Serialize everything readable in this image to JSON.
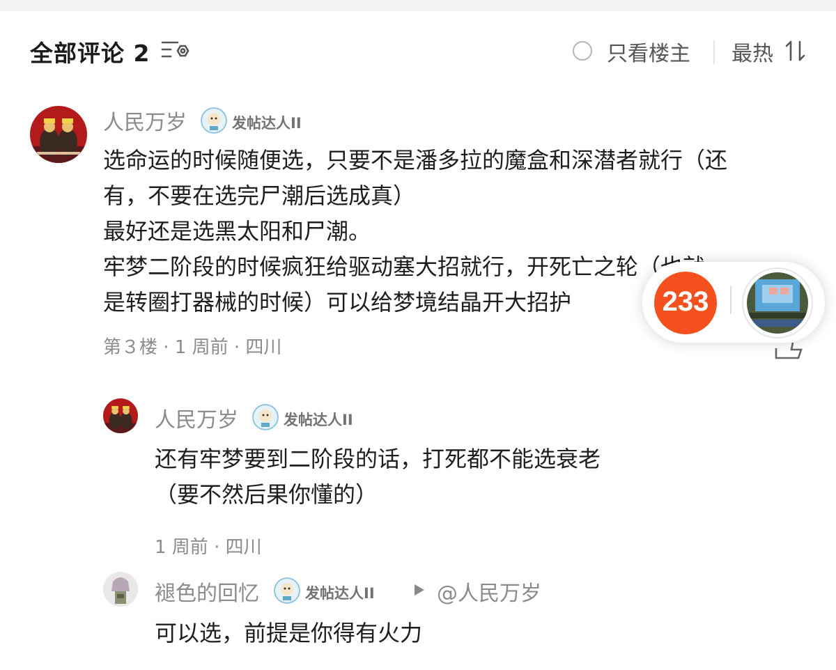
{
  "header": {
    "title": "全部评论 2",
    "only_op_label": "只看楼主",
    "sort_label": "最热"
  },
  "comments": [
    {
      "author": "人民万岁",
      "badge_label": "发帖达人II",
      "lines": [
        "选命运的时候随便选，只要不是潘多拉的魔盒和深潜者就行（还",
        "有，不要在选完尸潮后选成真）",
        "最好还是选黑太阳和尸潮。",
        "牢梦二阶段的时候疯狂给驱动塞大招就行，开死亡之轮（也就",
        "是转圈打器械的时候）可以给梦境结晶开大招护"
      ],
      "meta": "第３楼 · 1 周前 · 四川",
      "replies": [
        {
          "author": "人民万岁",
          "badge_label": "发帖达人II",
          "lines": [
            "还有牢梦要到二阶段的话，打死都不能选衰老",
            "（要不然后果你懂的）"
          ],
          "meta": "1 周前 · 四川"
        },
        {
          "author": "褪色的回忆",
          "badge_label": "发帖达人II",
          "reply_to": "@人民万岁",
          "lines": [
            "可以选，前提是你得有火力"
          ]
        }
      ]
    }
  ],
  "floating": {
    "left_badge_text": "233"
  },
  "colors": {
    "badge_233": "#f4511e",
    "secondary_text": "#8b8b8b",
    "primary_text": "#1e1e1e"
  },
  "icons": [
    "filter-settings-icon",
    "radio-circle-icon",
    "sort-icon",
    "reply-arrow-icon",
    "avatar-poster",
    "avatar-figure",
    "pixel-art-icon"
  ]
}
